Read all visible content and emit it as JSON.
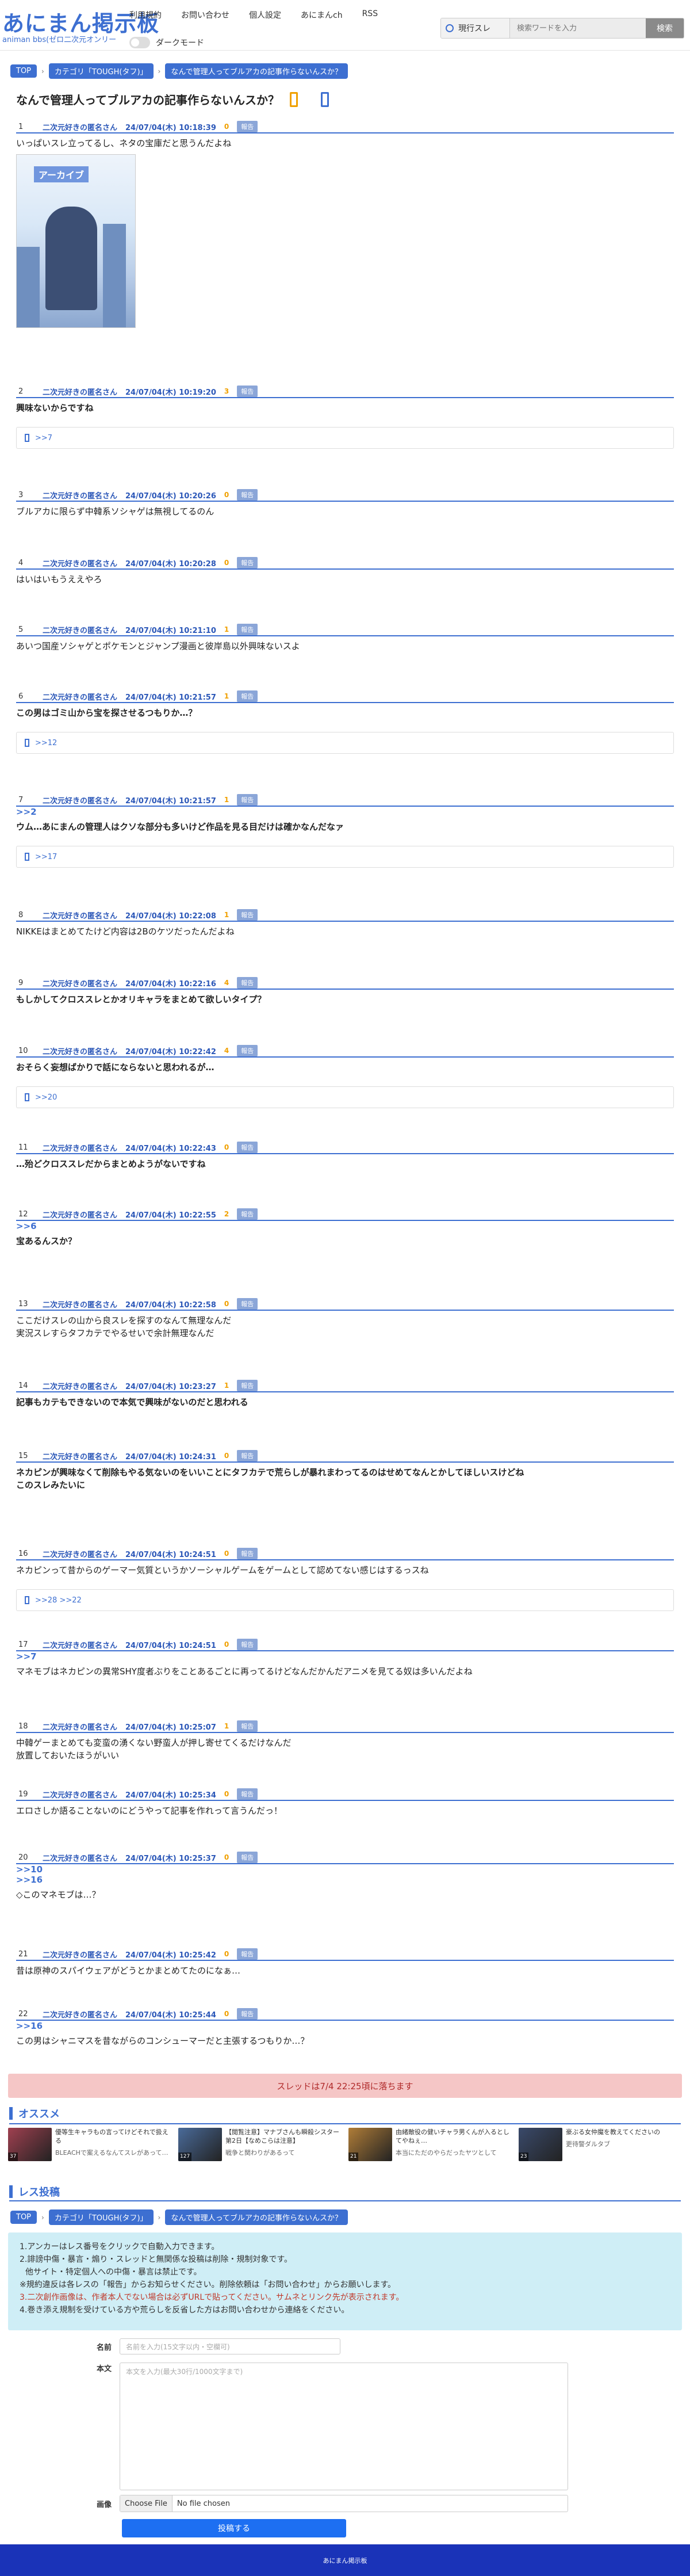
{
  "site": {
    "logo": "あにまん掲示板",
    "logo_sub": "animan bbs(ゼロ二次元オンリー"
  },
  "nav": [
    "利用規約",
    "お問い合わせ",
    "個人設定",
    "あにまんch",
    "RSS"
  ],
  "dark_mode_label": "ダークモード",
  "search": {
    "scope": "現行スレ",
    "placeholder": "検索ワードを入力",
    "button": "検索"
  },
  "breadcrumb": [
    "TOP",
    "カテゴリ「TOUGH(タフ)」",
    "なんで管理人ってブルアカの記事作らないんスか？"
  ],
  "thread_title": "なんで管理人ってブルアカの記事作らないんスか？",
  "post_common": {
    "name": "二次元好きの匿名さん",
    "report": "報告"
  },
  "posts": [
    {
      "num": "1",
      "date": "24/07/04(木) 10:18:39",
      "res": "0",
      "body": [
        "いっぱいスレ立ってるし、ネタの宝庫だと思うんだよね"
      ],
      "bold": false,
      "image": "アーカイブ"
    },
    {
      "num": "2",
      "date": "24/07/04(木) 10:19:20",
      "res": "3",
      "body": [
        "興味ないからですね"
      ],
      "bold": true,
      "reply": ">>7"
    },
    {
      "num": "3",
      "date": "24/07/04(木) 10:20:26",
      "res": "0",
      "body": [
        "ブルアカに限らず中韓系ソシャゲは無視してるのん"
      ],
      "bold": false
    },
    {
      "num": "4",
      "date": "24/07/04(木) 10:20:28",
      "res": "0",
      "body": [
        "はいはいもうええやろ"
      ],
      "bold": false
    },
    {
      "num": "5",
      "date": "24/07/04(木) 10:21:10",
      "res": "1",
      "body": [
        "あいつ国産ソシャゲとポケモンとジャンプ漫画と彼岸島以外興味ないスよ"
      ],
      "bold": false
    },
    {
      "num": "6",
      "date": "24/07/04(木) 10:21:57",
      "res": "1",
      "body": [
        "この男はゴミ山から宝を探させるつもりか…？"
      ],
      "bold": true,
      "reply": ">>12"
    },
    {
      "num": "7",
      "date": "24/07/04(木) 10:21:57",
      "res": "1",
      "anchor": ">>2",
      "body": [
        "ウム…あにまんの管理人はクソな部分も多いけど作品を見る目だけは確かなんだなァ"
      ],
      "bold": true,
      "reply": ">>17"
    },
    {
      "num": "8",
      "date": "24/07/04(木) 10:22:08",
      "res": "1",
      "body": [
        "NIKKEはまとめてたけど内容は2Bのケツだったんだよね"
      ],
      "bold": false
    },
    {
      "num": "9",
      "date": "24/07/04(木) 10:22:16",
      "res": "4",
      "body": [
        "もしかしてクロススレとかオリキャラをまとめて欲しいタイプ？"
      ],
      "bold": true
    },
    {
      "num": "10",
      "date": "24/07/04(木) 10:22:42",
      "res": "4",
      "body": [
        "おそらく妄想ばかりで話にならないと思われるが…"
      ],
      "bold": true,
      "reply": ">>20"
    },
    {
      "num": "11",
      "date": "24/07/04(木) 10:22:43",
      "res": "0",
      "body": [
        "…殆どクロススレだからまとめようがないですね"
      ],
      "bold": true
    },
    {
      "num": "12",
      "date": "24/07/04(木) 10:22:55",
      "res": "2",
      "anchor": ">>6",
      "body": [
        "宝あるんスか？"
      ],
      "bold": true
    },
    {
      "num": "13",
      "date": "24/07/04(木) 10:22:58",
      "res": "0",
      "body": [
        "ここだけスレの山から良スレを探すのなんて無理なんだ",
        "実況スレすらタフカテでやるせいで余計無理なんだ"
      ],
      "bold": false
    },
    {
      "num": "14",
      "date": "24/07/04(木) 10:23:27",
      "res": "1",
      "body": [
        "記事もカテもできないので本気で興味がないのだと思われる"
      ],
      "bold": true
    },
    {
      "num": "15",
      "date": "24/07/04(木) 10:24:31",
      "res": "0",
      "body": [
        "ネカピンが興味なくて削除もやる気ないのをいいことにタフカテで荒らしが暴れまわってるのはせめてなんとかしてほしいスけどね",
        "このスレみたいに"
      ],
      "bold": true
    },
    {
      "num": "16",
      "date": "24/07/04(木) 10:24:51",
      "res": "0",
      "body": [
        "ネカピンって昔からのゲーマー気質というかソーシャルゲームをゲームとして認めてない感じはするっスね"
      ],
      "bold": false,
      "reply": ">>28 >>22"
    },
    {
      "num": "17",
      "date": "24/07/04(木) 10:24:51",
      "res": "0",
      "anchor": ">>7",
      "body": [
        "マネモブはネカピンの異常SHY度者ぶりをことあるごとに再ってるけどなんだかんだアニメを見てる奴は多いんだよね"
      ],
      "bold": false
    },
    {
      "num": "18",
      "date": "24/07/04(木) 10:25:07",
      "res": "1",
      "body": [
        "中韓ゲーまとめても変蛮の湧くない野蛮人が押し寄せてくるだけなんだ",
        "放置しておいたほうがいい"
      ],
      "bold": false
    },
    {
      "num": "19",
      "date": "24/07/04(木) 10:25:34",
      "res": "0",
      "body": [
        "エロさしか語ることないのにどうやって記事を作れって言うんだっ！"
      ],
      "bold": false
    },
    {
      "num": "20",
      "date": "24/07/04(木) 10:25:37",
      "res": "0",
      "anchor": ">>10\n>>16",
      "body": [
        "◇このマネモブは…？"
      ],
      "bold": false
    },
    {
      "num": "21",
      "date": "24/07/04(木) 10:25:42",
      "res": "0",
      "body": [
        "昔は原神のスパイウェアがどうとかまとめてたのになぁ…"
      ],
      "bold": false
    },
    {
      "num": "22",
      "date": "24/07/04(木) 10:25:44",
      "res": "0",
      "anchor": ">>16",
      "body": [
        "この男はシャニマスを昔ながらのコンシューマーだと主張するつもりか…？"
      ],
      "bold": false
    }
  ],
  "closing_notice": "スレッドは7/4 22:25頃に落ちます",
  "recommend": {
    "title": "オススメ",
    "items": [
      {
        "count": "37",
        "title": "優等生キャラもの言ってけどそれで扱える",
        "sub": "BLEACHで案えるなんてスレがあって…",
        "color": "#a04050"
      },
      {
        "count": "127",
        "title": "【閲覧注意】マナブさんも瞬殺シスター第2日【なめこらは注意】",
        "sub": "戦争と関わりがあるって",
        "color": "#4a6b9a"
      },
      {
        "count": "21",
        "title": "由緒敵役の健いチャラ男くんが入るとしてやねぇ…",
        "sub": "本当にただのやらだったヤツとして",
        "color": "#b07d38"
      },
      {
        "count": "23",
        "title": "豪ぶる女仲魔を教えてくださいの",
        "sub": "更待警ダルタブ",
        "color": "#3a4a6b"
      }
    ]
  },
  "post_section_title": "レス投稿",
  "rules": [
    {
      "text": "1.アンカーはレス番号をクリックで自動入力できます。",
      "red": false
    },
    {
      "text": "2.誹謗中傷・暴言・煽り・スレッドと無関係な投稿は削除・規制対象です。",
      "red": false
    },
    {
      "text": "  他サイト・特定個人への中傷・暴言は禁止です。",
      "red": false
    },
    {
      "text": "※規約違反は各レスの「報告」からお知らせください。削除依頼は「お問い合わせ」からお願いします。",
      "red": false
    },
    {
      "text": "3.二次創作画像は、作者本人でない場合は必ずURLで貼ってください。サムネとリンク先が表示されます。",
      "red": true
    },
    {
      "text": "4.巻き添え規制を受けている方や荒らしを反省した方はお問い合わせから連絡をください。",
      "red": false
    }
  ],
  "form": {
    "name_label": "名前",
    "name_placeholder": "名前を入力(15文字以内・空欄可)",
    "body_label": "本文",
    "body_placeholder": "本文を入力(最大30行/1000文字まで)",
    "image_label": "画像",
    "file_button": "Choose File",
    "file_text": "No file chosen",
    "submit": "投稿する"
  },
  "footer": "あにまん掲示板"
}
